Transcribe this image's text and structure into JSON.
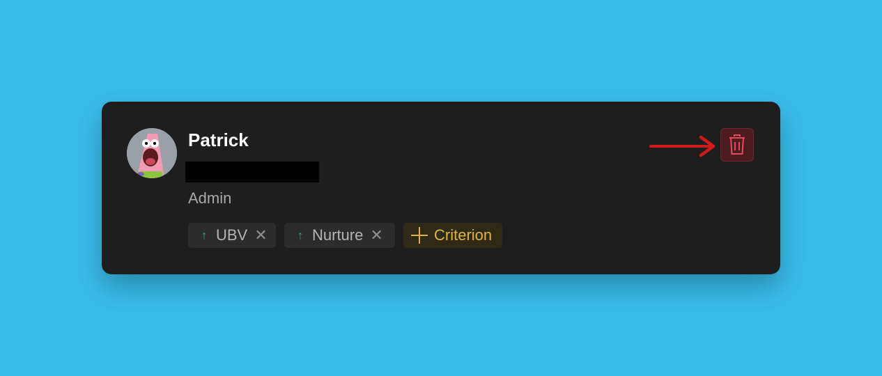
{
  "user": {
    "name": "Patrick",
    "role": "Admin",
    "avatar_icon": "patrick-star-avatar"
  },
  "tags": [
    {
      "label": "UBV",
      "direction_icon": "arrow-up-icon",
      "remove_icon": "close-icon"
    },
    {
      "label": "Nurture",
      "direction_icon": "arrow-up-icon",
      "remove_icon": "close-icon"
    }
  ],
  "add_tag": {
    "label": "Criterion",
    "icon": "plus-icon"
  },
  "actions": {
    "delete_icon": "trash-icon"
  },
  "annotation": {
    "icon": "arrow-right-icon",
    "color": "#d11a1a"
  },
  "colors": {
    "background": "#39bdeb",
    "card": "#1e1e1e",
    "accent_yellow": "#e0b341",
    "up_green": "#3a9a5c",
    "danger": "#e34b5a"
  }
}
